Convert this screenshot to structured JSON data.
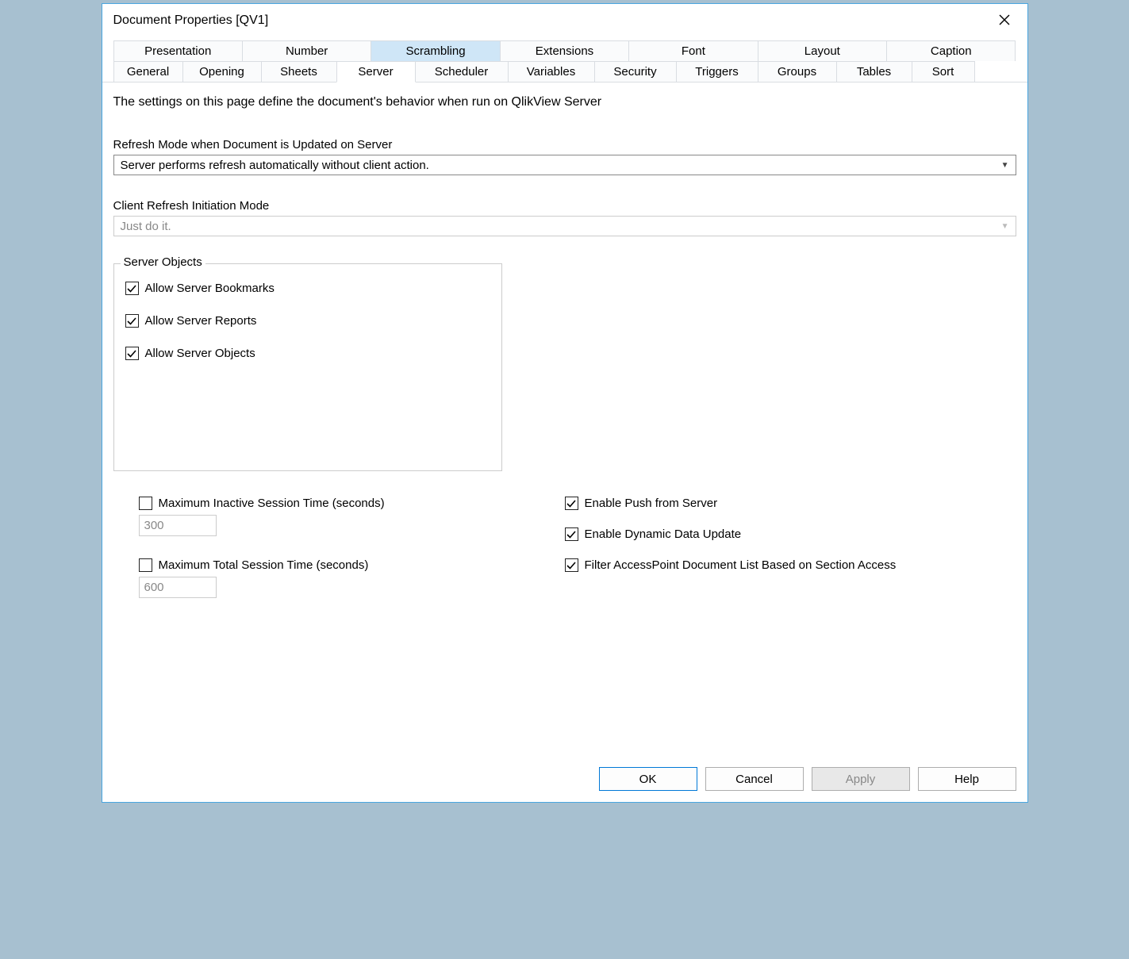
{
  "dialog": {
    "title": "Document Properties [QV1]",
    "close_icon_name": "close-icon"
  },
  "tabs_top": [
    {
      "label": "Presentation",
      "highlighted": false
    },
    {
      "label": "Number",
      "highlighted": false
    },
    {
      "label": "Scrambling",
      "highlighted": true
    },
    {
      "label": "Extensions",
      "highlighted": false
    },
    {
      "label": "Font",
      "highlighted": false
    },
    {
      "label": "Layout",
      "highlighted": false
    },
    {
      "label": "Caption",
      "highlighted": false
    }
  ],
  "tabs_bottom": [
    {
      "label": "General",
      "active": false
    },
    {
      "label": "Opening",
      "active": false
    },
    {
      "label": "Sheets",
      "active": false
    },
    {
      "label": "Server",
      "active": true
    },
    {
      "label": "Scheduler",
      "active": false
    },
    {
      "label": "Variables",
      "active": false
    },
    {
      "label": "Security",
      "active": false
    },
    {
      "label": "Triggers",
      "active": false
    },
    {
      "label": "Groups",
      "active": false
    },
    {
      "label": "Tables",
      "active": false
    },
    {
      "label": "Sort",
      "active": false
    }
  ],
  "server_tab": {
    "intro": "The settings on this page define the document's behavior when run on QlikView Server",
    "refresh_mode_label": "Refresh Mode when Document is Updated on Server",
    "refresh_mode_value": "Server performs refresh automatically without client action.",
    "client_refresh_label": "Client Refresh Initiation Mode",
    "client_refresh_value": "Just do it.",
    "server_objects": {
      "legend": "Server Objects",
      "allow_bookmarks": {
        "label": "Allow Server Bookmarks",
        "checked": true
      },
      "allow_reports": {
        "label": "Allow Server Reports",
        "checked": true
      },
      "allow_objects": {
        "label": "Allow Server Objects",
        "checked": true
      }
    },
    "max_inactive": {
      "label": "Maximum Inactive Session Time (seconds)",
      "checked": false,
      "value": "300"
    },
    "max_total": {
      "label": "Maximum Total Session Time (seconds)",
      "checked": false,
      "value": "600"
    },
    "enable_push": {
      "label": "Enable Push from Server",
      "checked": true
    },
    "enable_dynamic": {
      "label": "Enable Dynamic Data Update",
      "checked": true
    },
    "filter_access": {
      "label": "Filter AccessPoint Document List Based on Section Access",
      "checked": true
    }
  },
  "buttons": {
    "ok": "OK",
    "cancel": "Cancel",
    "apply": "Apply",
    "help": "Help"
  }
}
